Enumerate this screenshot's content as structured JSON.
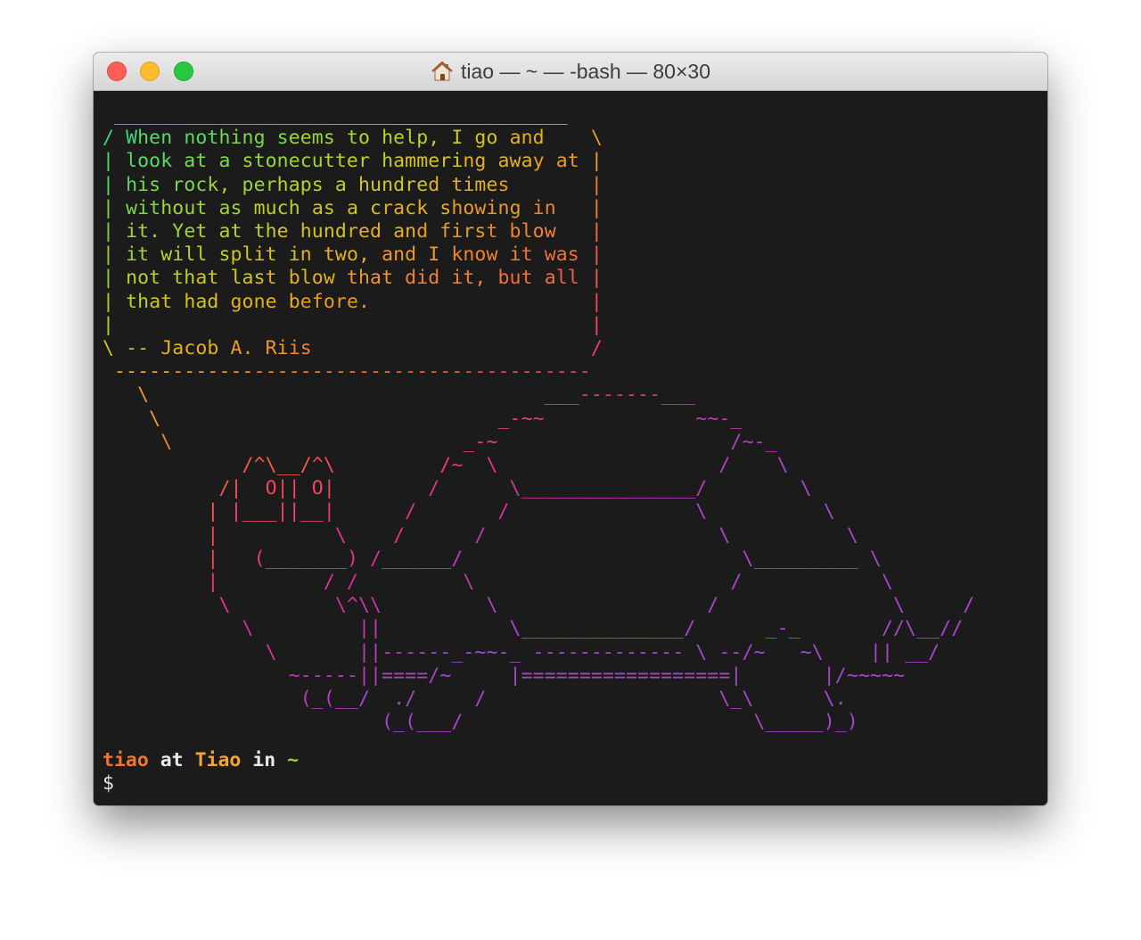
{
  "window": {
    "title": "tiao — ~ — -bash — 80×30",
    "icon": "home-icon"
  },
  "terminal": {
    "art_lines": [
      " _______________________________________",
      "/ When nothing seems to help, I go and    \\",
      "| look at a stonecutter hammering away at |",
      "| his rock, perhaps a hundred times       |",
      "| without as much as a crack showing in   |",
      "| it. Yet at the hundred and first blow   |",
      "| it will split in two, and I know it was |",
      "| not that last blow that did it, but all |",
      "| that had gone before.                   |",
      "|                                         |",
      "\\ -- Jacob A. Riis                        /",
      " -----------------------------------------",
      "   \\                                  ___-------___",
      "    \\                             _-~~             ~~-_",
      "     \\                         _-~                    /~-_",
      "            /^\\__/^\\         /~  \\                   /    \\",
      "          /|  O|| O|        /      \\_______________/        \\",
      "         | |___||__|      /       /                \\          \\",
      "         |          \\    /      /                    \\          \\",
      "         |   (_______) /______/                        \\_________ \\",
      "         |         / /         \\                      /            \\",
      "          \\         \\^\\\\         \\                  /               \\     /",
      "            \\         ||           \\______________/      _-_       //\\__//",
      "              \\       ||------_-~~-_ ------------- \\ --/~   ~\\    || __/",
      "                ~-----||====/~     |==================|       |/~~~~~",
      "                 (_(__/  ./     /                    \\_\\      \\.",
      "                        (_(___/                         \\_____)_)"
    ],
    "prompt": {
      "user": "tiao",
      "at": " at ",
      "host": "Tiao",
      "in": " in ",
      "dir": "~"
    },
    "command_line": "$ "
  },
  "colors": {
    "terminal_bg": "#1b1b1b",
    "rainbow": [
      "#3bd77f",
      "#57d965",
      "#7bd84b",
      "#9dd537",
      "#bcd027",
      "#d3c41f",
      "#e3b11f",
      "#eb9a25",
      "#f08330",
      "#f36d3d",
      "#f4594d",
      "#f2475f",
      "#ec3b73",
      "#e33488",
      "#d7329c",
      "#c935af",
      "#b93cc0",
      "#a845cf"
    ]
  }
}
